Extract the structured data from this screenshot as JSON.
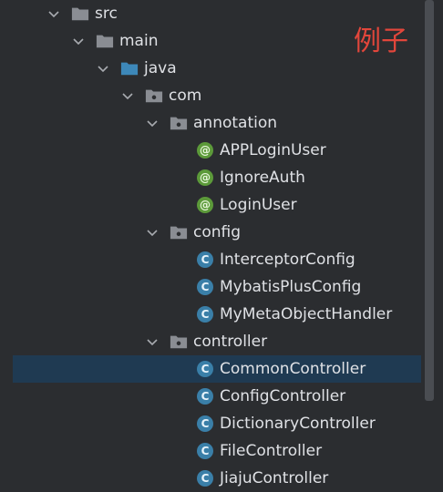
{
  "overlay_text": "例子",
  "tree": {
    "src": "src",
    "main": "main",
    "java": "java",
    "com": "com",
    "annotation": "annotation",
    "annotation_items": [
      "APPLoginUser",
      "IgnoreAuth",
      "LoginUser"
    ],
    "config": "config",
    "config_items": [
      "InterceptorConfig",
      "MybatisPlusConfig",
      "MyMetaObjectHandler"
    ],
    "controller": "controller",
    "controller_items": [
      "CommonController",
      "ConfigController",
      "DictionaryController",
      "FileController",
      "JiajuController"
    ]
  },
  "icons": {
    "annotation_badge": "@",
    "class_badge": "C"
  },
  "colors": {
    "background": "#2b2d30",
    "selection": "#1f3a52",
    "annotation_badge": "#5c9a3a",
    "class_badge": "#3a7fa8",
    "java_folder": "#3d88b9",
    "overlay_text": "#e2463b"
  },
  "selected_item": "CommonController"
}
